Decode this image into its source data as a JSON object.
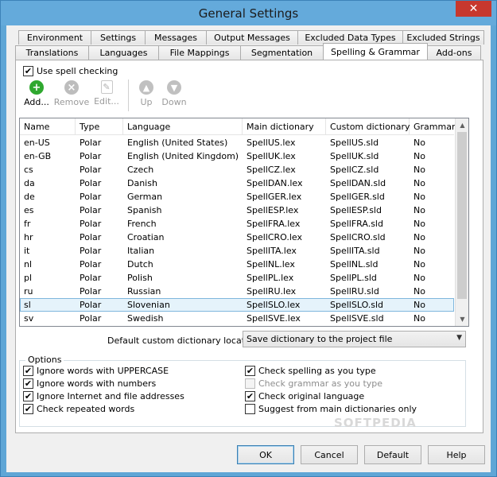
{
  "window": {
    "title": "General Settings",
    "close_glyph": "✕"
  },
  "tabs": {
    "row1": [
      "Environment",
      "Settings",
      "Messages",
      "Output Messages",
      "Excluded Data Types",
      "Excluded Strings"
    ],
    "row2": [
      "Translations",
      "Languages",
      "File Mappings",
      "Segmentation",
      "Spelling & Grammar",
      "Add-ons"
    ],
    "active": "Spelling & Grammar"
  },
  "spell": {
    "use_label": "Use spell checking",
    "checked": true
  },
  "toolbar": {
    "add": "Add...",
    "remove": "Remove",
    "edit": "Edit...",
    "up": "Up",
    "down": "Down",
    "icons": {
      "add": "add-icon",
      "remove": "remove-icon",
      "edit": "edit-icon",
      "up": "up-arrow-icon",
      "down": "down-arrow-icon"
    },
    "add_color": "#2fa82f"
  },
  "table": {
    "columns": [
      "Name",
      "Type",
      "Language",
      "Main dictionary",
      "Custom dictionary",
      "Grammar"
    ],
    "rows": [
      [
        "en-US",
        "Polar",
        "English (United States)",
        "SpellUS.lex",
        "SpellUS.sld",
        "No"
      ],
      [
        "en-GB",
        "Polar",
        "English (United Kingdom)",
        "SpellUK.lex",
        "SpellUK.sld",
        "No"
      ],
      [
        "cs",
        "Polar",
        "Czech",
        "SpellCZ.lex",
        "SpellCZ.sld",
        "No"
      ],
      [
        "da",
        "Polar",
        "Danish",
        "SpellDAN.lex",
        "SpellDAN.sld",
        "No"
      ],
      [
        "de",
        "Polar",
        "German",
        "SpellGER.lex",
        "SpellGER.sld",
        "No"
      ],
      [
        "es",
        "Polar",
        "Spanish",
        "SpellESP.lex",
        "SpellESP.sld",
        "No"
      ],
      [
        "fr",
        "Polar",
        "French",
        "SpellFRA.lex",
        "SpellFRA.sld",
        "No"
      ],
      [
        "hr",
        "Polar",
        "Croatian",
        "SpellCRO.lex",
        "SpellCRO.sld",
        "No"
      ],
      [
        "it",
        "Polar",
        "Italian",
        "SpellITA.lex",
        "SpellITA.sld",
        "No"
      ],
      [
        "nl",
        "Polar",
        "Dutch",
        "SpellNL.lex",
        "SpellNL.sld",
        "No"
      ],
      [
        "pl",
        "Polar",
        "Polish",
        "SpellPL.lex",
        "SpellPL.sld",
        "No"
      ],
      [
        "ru",
        "Polar",
        "Russian",
        "SpellRU.lex",
        "SpellRU.sld",
        "No"
      ],
      [
        "sl",
        "Polar",
        "Slovenian",
        "SpellSLO.lex",
        "SpellSLO.sld",
        "No"
      ],
      [
        "sv",
        "Polar",
        "Swedish",
        "SpellSVE.lex",
        "SpellSVE.sld",
        "No"
      ]
    ],
    "selected": "sl"
  },
  "location": {
    "label": "Default custom dictionary location:",
    "value": "Save dictionary to the project file"
  },
  "options": {
    "legend": "Options",
    "left": [
      {
        "label": "Ignore words with UPPERCASE",
        "checked": true,
        "enabled": true
      },
      {
        "label": "Ignore words with numbers",
        "checked": true,
        "enabled": true
      },
      {
        "label": "Ignore Internet and file addresses",
        "checked": true,
        "enabled": true
      },
      {
        "label": "Check repeated words",
        "checked": true,
        "enabled": true
      }
    ],
    "right": [
      {
        "label": "Check spelling as you type",
        "checked": true,
        "enabled": true
      },
      {
        "label": "Check grammar as you type",
        "checked": false,
        "enabled": false
      },
      {
        "label": "Check original language",
        "checked": true,
        "enabled": true
      },
      {
        "label": "Suggest from main dictionaries only",
        "checked": false,
        "enabled": true
      }
    ]
  },
  "buttons": {
    "ok": "OK",
    "cancel": "Cancel",
    "default": "Default",
    "help": "Help"
  },
  "watermark": "SOFTPEDIA"
}
